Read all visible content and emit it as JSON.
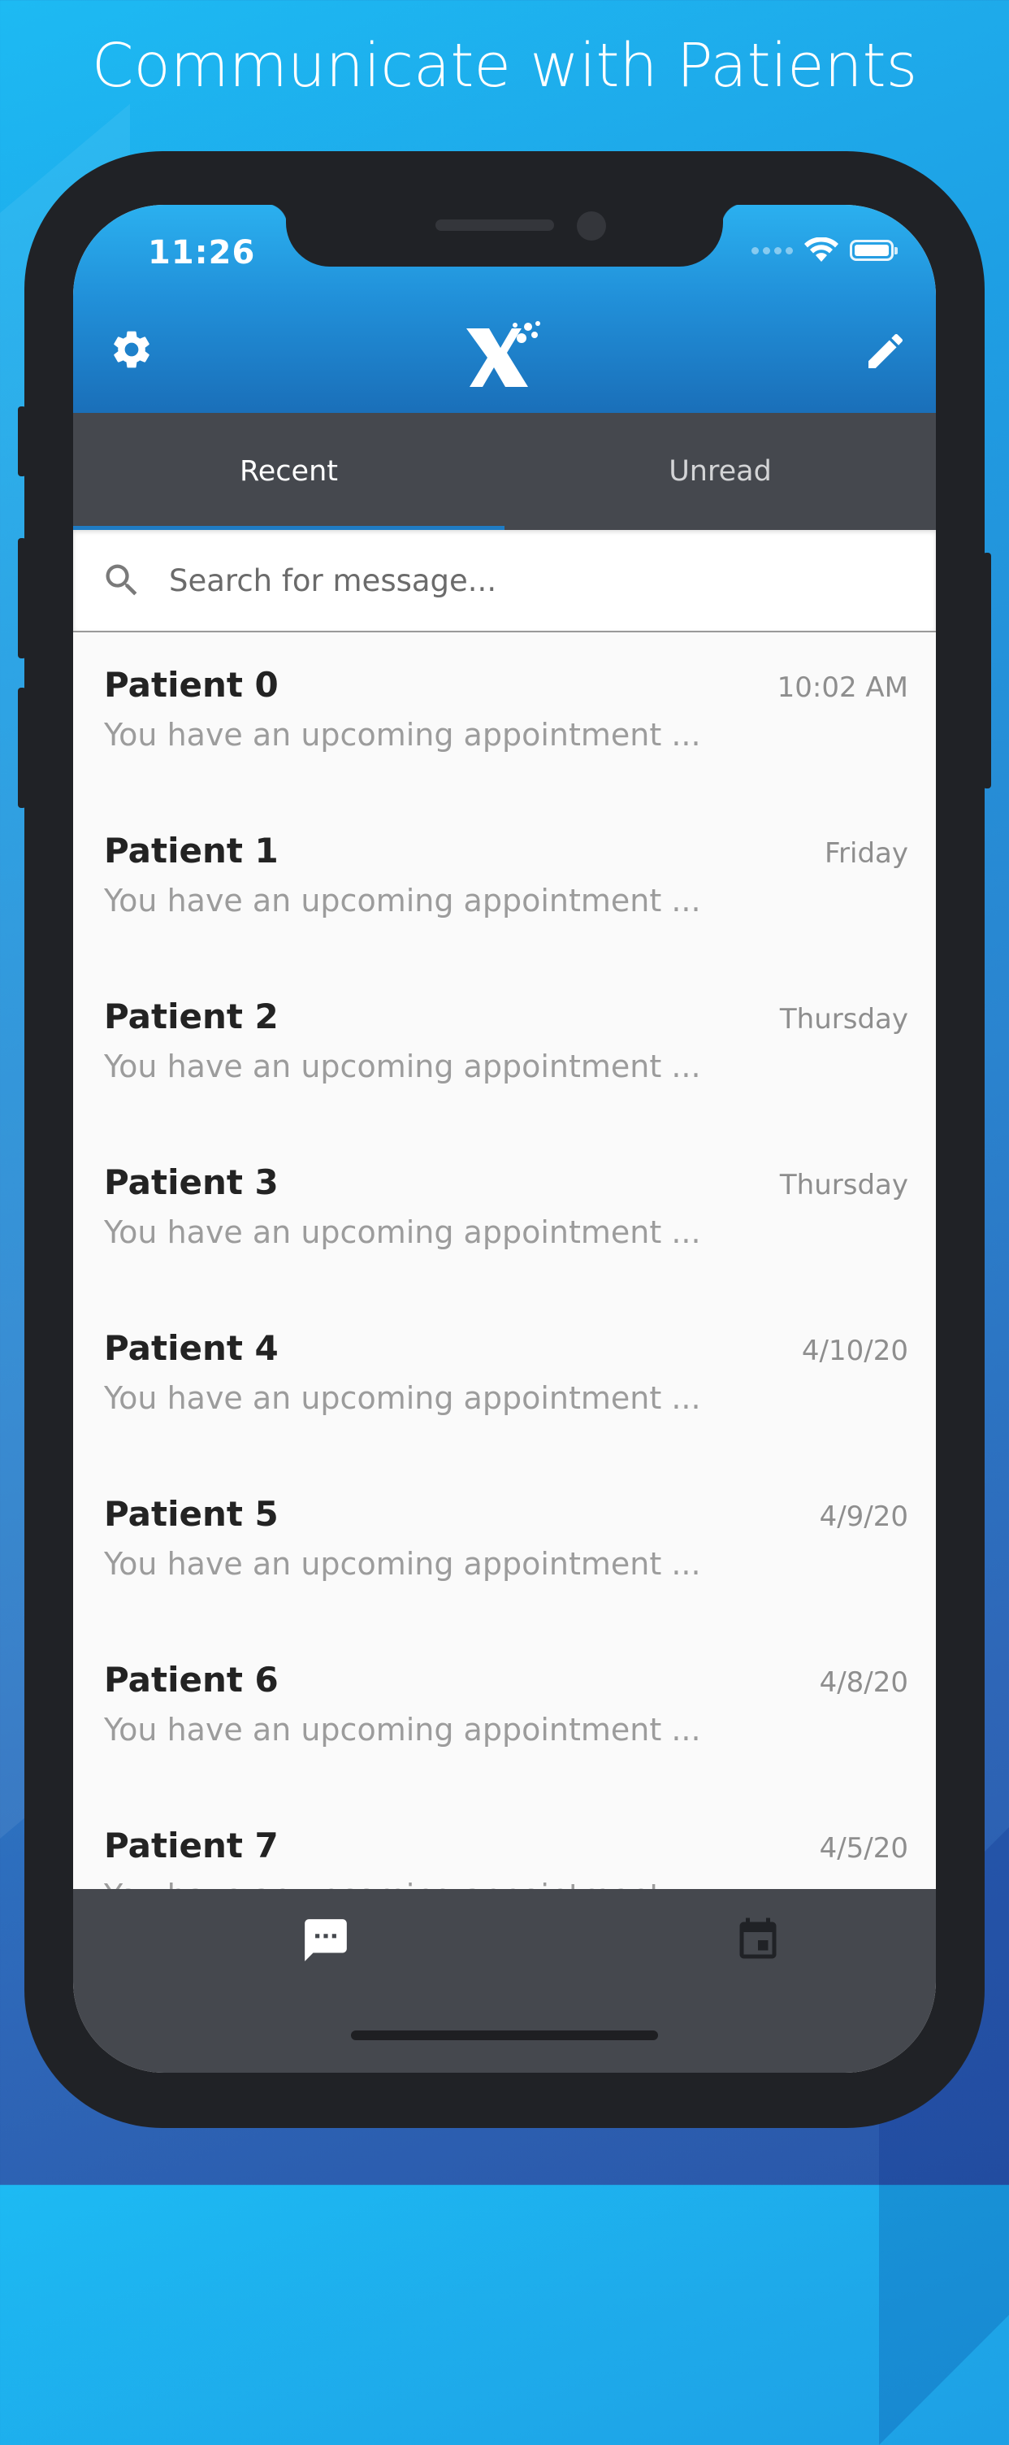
{
  "headline": "Communicate with Patients",
  "status_bar": {
    "time": "11:26"
  },
  "app_bar": {
    "settings_icon": "gear-icon",
    "logo_icon": "x-logo-icon",
    "compose_icon": "pencil-icon"
  },
  "tabs": [
    {
      "label": "Recent",
      "active": true
    },
    {
      "label": "Unread",
      "active": false
    }
  ],
  "search": {
    "placeholder": "Search for message...",
    "value": ""
  },
  "messages": [
    {
      "name": "Patient 0",
      "time": "10:02 AM",
      "preview": "You have an upcoming appointment ..."
    },
    {
      "name": "Patient 1",
      "time": "Friday",
      "preview": "You have an upcoming appointment ..."
    },
    {
      "name": "Patient 2",
      "time": "Thursday",
      "preview": "You have an upcoming appointment ..."
    },
    {
      "name": "Patient 3",
      "time": "Thursday",
      "preview": "You have an upcoming appointment ..."
    },
    {
      "name": "Patient 4",
      "time": "4/10/20",
      "preview": "You have an upcoming appointment ..."
    },
    {
      "name": "Patient 5",
      "time": "4/9/20",
      "preview": "You have an upcoming appointment ..."
    },
    {
      "name": "Patient 6",
      "time": "4/8/20",
      "preview": "You have an upcoming appointment ..."
    },
    {
      "name": "Patient 7",
      "time": "4/5/20",
      "preview": "You have an upcoming appointment ..."
    }
  ],
  "bottom_nav": {
    "messages_icon": "chat-bubble-icon",
    "calendar_icon": "calendar-icon"
  },
  "colors": {
    "background_top": "#1dbaf3",
    "background_bottom": "#2a57a9",
    "app_bar": "#2190d9",
    "tab_bar": "#45484e",
    "tab_indicator": "#1f7cc4",
    "phone_frame": "#202226"
  }
}
